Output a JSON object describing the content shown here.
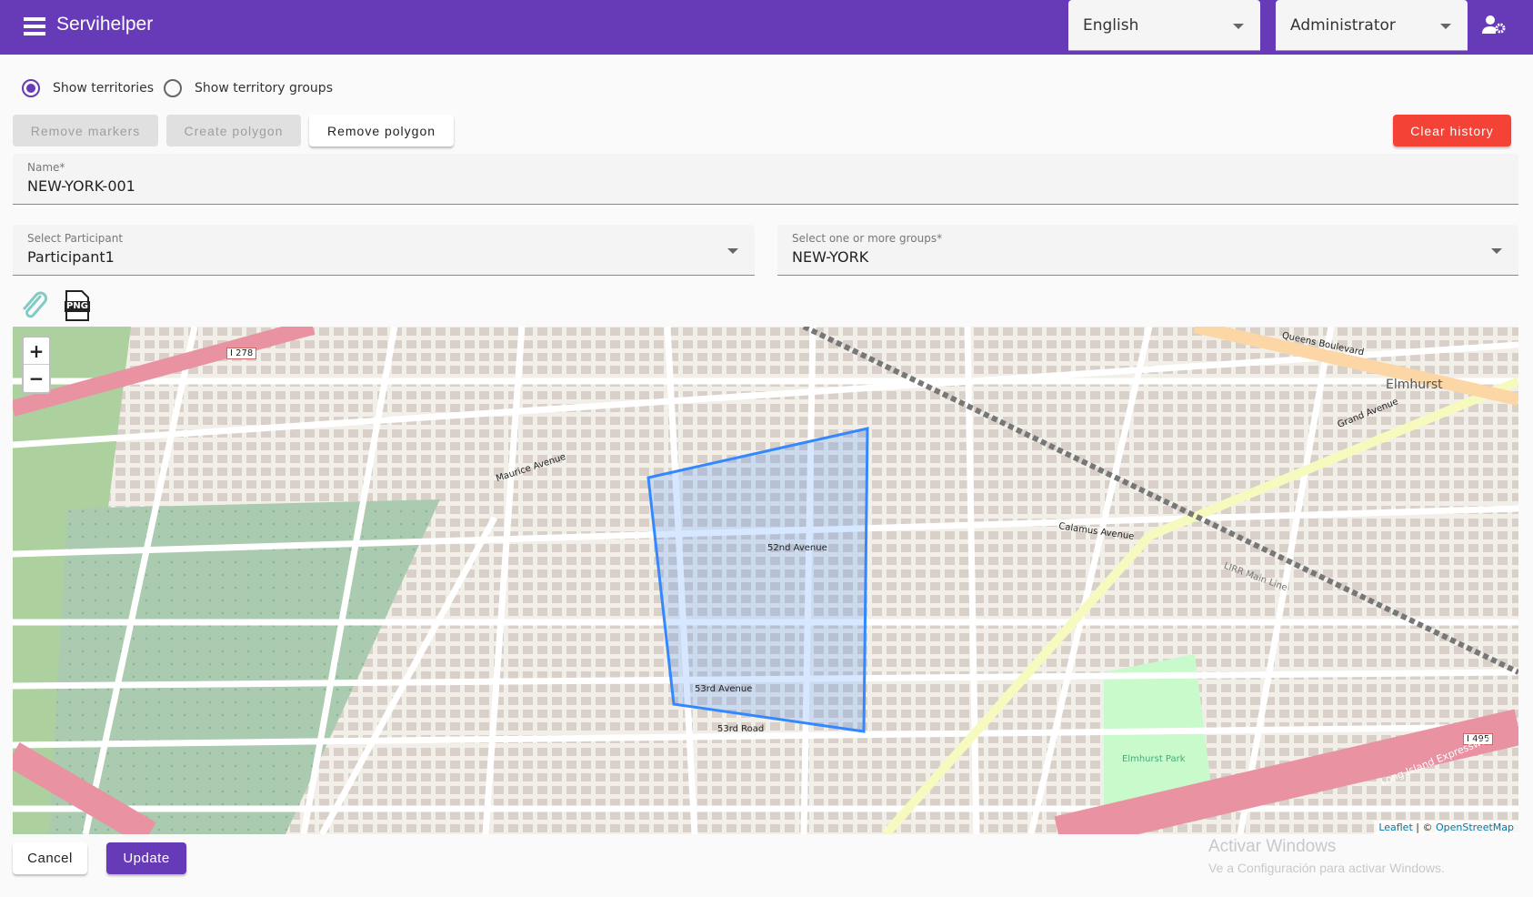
{
  "header": {
    "title": "Servihelper",
    "language": "English",
    "role": "Administrator"
  },
  "view": {
    "show_territories": "Show territories",
    "show_groups": "Show territory groups",
    "selected": "territories"
  },
  "toolbar": {
    "remove_markers": "Remove markers",
    "create_polygon": "Create polygon",
    "remove_polygon": "Remove polygon",
    "clear_history": "Clear history"
  },
  "form": {
    "name": {
      "label": "Name*",
      "value": "NEW-YORK-001"
    },
    "participant": {
      "label": "Select Participant",
      "value": "Participant1"
    },
    "groups": {
      "label": "Select one or more groups*",
      "value": "NEW-YORK"
    }
  },
  "attachments": {
    "png_label": "PNG"
  },
  "map": {
    "zoom_in": "+",
    "zoom_out": "−",
    "attribution": {
      "leaflet": "Leaflet",
      "separator": " | © ",
      "osm": "OpenStreetMap"
    },
    "labels": {
      "elmhurst": "Elmhurst",
      "queens_blvd": "Queens Boulevard",
      "grand_ave": "Grand Avenue",
      "maurice_ave": "Maurice Avenue",
      "calamus_ave": "Calamus Avenue",
      "ave52": "52nd Avenue",
      "ave53": "53rd Avenue",
      "rd53": "53rd Road",
      "i495": "I 495",
      "i278": "I 278",
      "lie": "Long Island Expressway",
      "park": "Elmhurst Park",
      "lirr": "LIRR Main Line"
    },
    "colors": {
      "polygon": "#3388ff",
      "background": "#f2efe9",
      "park": "#add19e",
      "motorway": "#e892a2"
    }
  },
  "footer": {
    "cancel": "Cancel",
    "update": "Update"
  },
  "watermark": {
    "title": "Activar Windows",
    "subtitle": "Ve a Configuración para activar Windows."
  },
  "colors": {
    "primary": "#673ab7",
    "danger": "#f44336"
  }
}
